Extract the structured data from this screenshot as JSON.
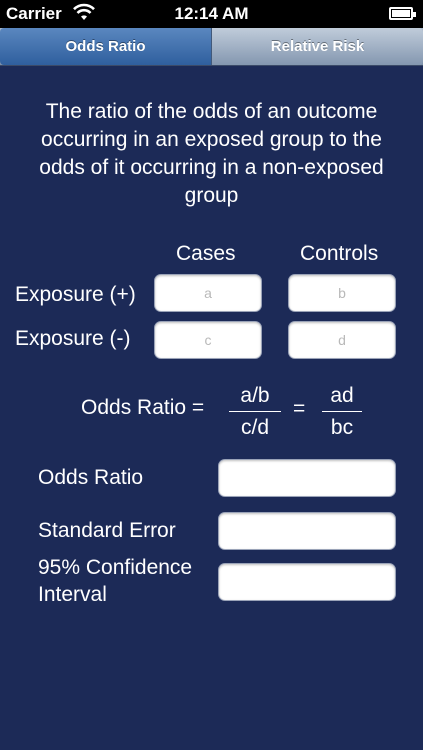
{
  "status": {
    "carrier": "Carrier",
    "time": "12:14 AM"
  },
  "tabs": {
    "left": "Odds Ratio",
    "right": "Relative Risk"
  },
  "description": "The ratio of the odds of an outcome occurring in an exposed group to the odds of it occurring in a non-exposed group",
  "table": {
    "col_cases": "Cases",
    "col_controls": "Controls",
    "row_pos": "Exposure (+)",
    "row_neg": "Exposure (-)",
    "placeholders": {
      "a": "a",
      "b": "b",
      "c": "c",
      "d": "d"
    }
  },
  "formula": {
    "label": "Odds Ratio =",
    "num1": "a/b",
    "den1": "c/d",
    "equals": "=",
    "num2": "ad",
    "den2": "bc"
  },
  "results": {
    "odds_ratio": "Odds Ratio",
    "std_error": "Standard Error",
    "ci_line1": "95% Confidence",
    "ci_line2": "Interval"
  }
}
